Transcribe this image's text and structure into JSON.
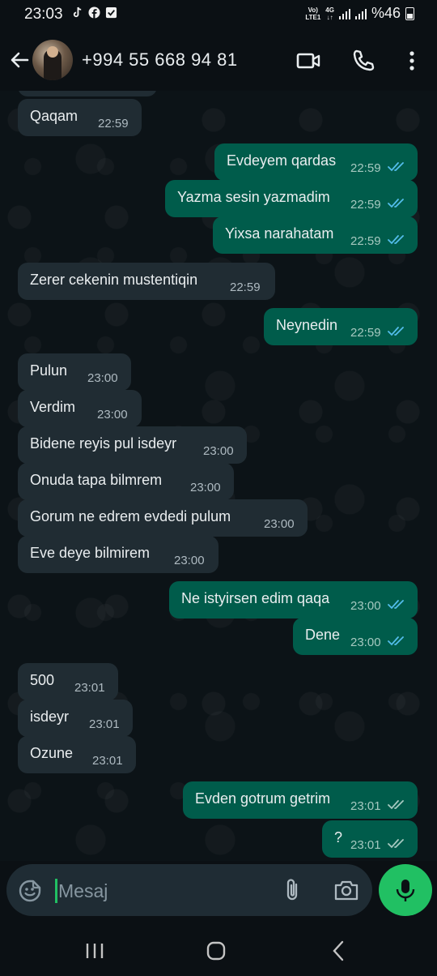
{
  "status": {
    "time": "23:03",
    "battery": "%46",
    "network": "4G",
    "volte_line1": "Vo)",
    "volte_line2": "LTE1"
  },
  "header": {
    "contact": "+994 55 668 94 81"
  },
  "messages": [
    {
      "dir": "in",
      "text": "Qaqam",
      "time": "22:59"
    },
    {
      "dir": "out",
      "text": "Evdeyem qardas",
      "time": "22:59",
      "status": "read"
    },
    {
      "dir": "out",
      "text": "Yazma sesin yazmadim",
      "time": "22:59",
      "status": "read"
    },
    {
      "dir": "out",
      "text": "Yixsa narahatam",
      "time": "22:59",
      "status": "read"
    },
    {
      "dir": "in",
      "text": "Zerer cekenin mustentiqin",
      "time": "22:59"
    },
    {
      "dir": "out",
      "text": "Neynedin",
      "time": "22:59",
      "status": "read"
    },
    {
      "dir": "in",
      "text": "Pulun",
      "time": "23:00"
    },
    {
      "dir": "in",
      "text": "Verdim",
      "time": "23:00"
    },
    {
      "dir": "in",
      "text": "Bidene reyis pul isdeyr",
      "time": "23:00"
    },
    {
      "dir": "in",
      "text": "Onuda tapa bilmrem",
      "time": "23:00"
    },
    {
      "dir": "in",
      "text": "Gorum ne edrem evdedi pulum",
      "time": "23:00"
    },
    {
      "dir": "in",
      "text": "Eve deye bilmirem",
      "time": "23:00"
    },
    {
      "dir": "out",
      "text": "Ne istyirsen edim qaqa",
      "time": "23:00",
      "status": "read"
    },
    {
      "dir": "out",
      "text": "Dene",
      "time": "23:00",
      "status": "read"
    },
    {
      "dir": "in",
      "text": "500",
      "time": "23:01"
    },
    {
      "dir": "in",
      "text": "isdeyr",
      "time": "23:01"
    },
    {
      "dir": "in",
      "text": "Ozune",
      "time": "23:01"
    },
    {
      "dir": "out",
      "text": "Evden gotrum getrim",
      "time": "23:01",
      "status": "delivered"
    },
    {
      "dir": "out",
      "text": "?",
      "time": "23:01",
      "status": "delivered"
    }
  ],
  "composer": {
    "placeholder": "Mesaj"
  },
  "colors": {
    "incoming": "#202c33",
    "outgoing": "#005c4b",
    "read_tick": "#53bdeb",
    "delivered_tick": "#a6c9c0",
    "accent": "#21c063"
  },
  "icons": [
    "back-arrow-icon",
    "video-call-icon",
    "voice-call-icon",
    "more-options-icon",
    "sticker-icon",
    "attach-icon",
    "camera-icon",
    "mic-icon",
    "recent-apps-icon",
    "home-icon",
    "nav-back-icon"
  ]
}
